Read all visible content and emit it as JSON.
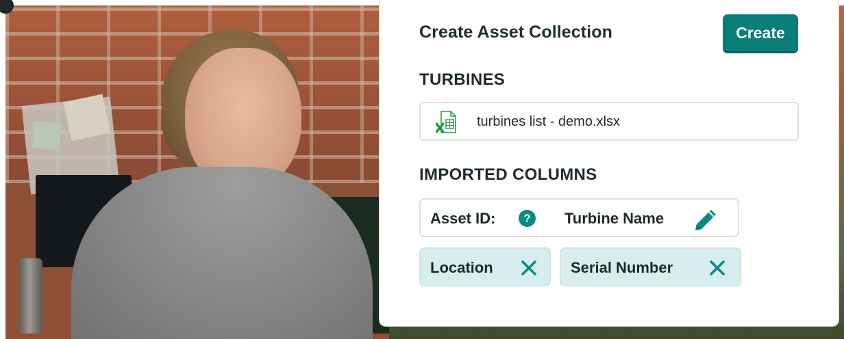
{
  "card": {
    "title": "Create Asset Collection",
    "create_button_label": "Create"
  },
  "turbines": {
    "heading": "TURBINES",
    "file_name": "turbines list - demo.xlsx",
    "file_icon": "excel-file-icon"
  },
  "imported_columns": {
    "heading": "IMPORTED COLUMNS",
    "asset_id": {
      "label": "Asset ID:",
      "help_icon": "?",
      "value": "Turbine Name",
      "edit_icon": "pencil-icon"
    },
    "columns": [
      {
        "label": "Location",
        "remove_icon": "close-icon"
      },
      {
        "label": "Serial Number",
        "remove_icon": "close-icon"
      }
    ]
  },
  "colors": {
    "accent": "#0a7d78",
    "chip_fill": "#d8eeee",
    "excel_green": "#1d9b3f"
  }
}
